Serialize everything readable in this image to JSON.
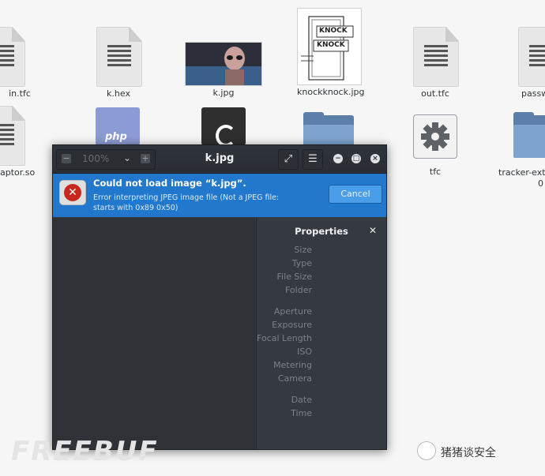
{
  "desktop": {
    "files_row1": [
      "in.tfc",
      "k.hex",
      "k.jpg",
      "knockknock.jpg",
      "out.tfc",
      "passw"
    ],
    "files_row2": [
      "aptor.so",
      "tfc",
      "tracker-extr",
      "0"
    ],
    "thumb_text": [
      "KNOCK",
      "KNOCK"
    ],
    "php_label": "php"
  },
  "viewer": {
    "title": "k.jpg",
    "zoom": "100%",
    "icons": [
      "zoom-out-icon",
      "chevron-down-icon",
      "zoom-in-icon",
      "fullscreen-icon",
      "menu-icon",
      "minimize-icon",
      "maximize-icon",
      "close-icon"
    ],
    "error": {
      "title": "Could not load image “k.jpg”.",
      "message": "Error interpreting JPEG image file (Not a JPEG file: starts with 0x89 0x50)",
      "cancel": "Cancel"
    },
    "properties": {
      "heading": "Properties",
      "group1": [
        "Size",
        "Type",
        "File Size",
        "Folder"
      ],
      "group2": [
        "Aperture",
        "Exposure",
        "Focal Length",
        "ISO",
        "Metering",
        "Camera"
      ],
      "group3": [
        "Date",
        "Time"
      ]
    }
  },
  "watermark": {
    "left": "FREEBUF",
    "right": "猪猪谈安全"
  },
  "colors": {
    "info_bar": "#2278cc",
    "cancel": "#4a9de8",
    "error_red": "#c8291e"
  }
}
